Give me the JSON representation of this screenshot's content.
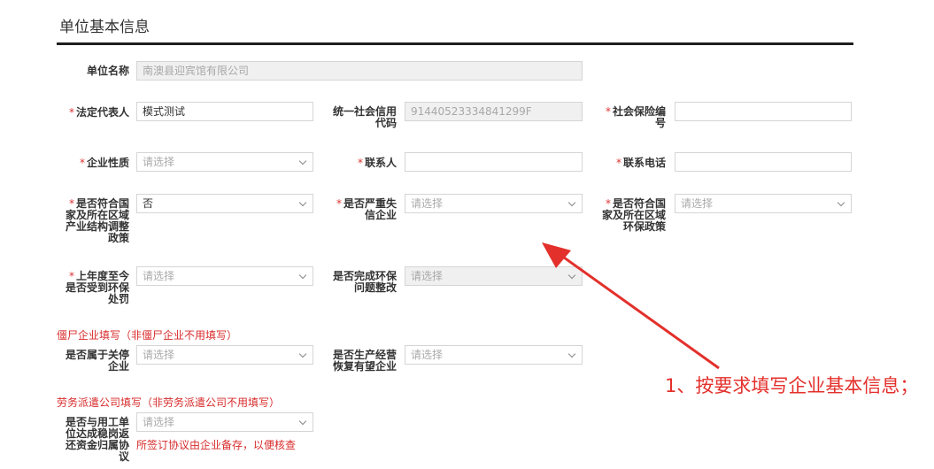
{
  "section": {
    "title": "单位基本信息"
  },
  "fields": {
    "unit_name": {
      "label": "单位名称",
      "value": "南澳县迎宾馆有限公司"
    },
    "legal_rep": {
      "label": "法定代表人",
      "value": "模式测试"
    },
    "credit_code": {
      "label": "统一社会信用代码",
      "value": "91440523334841299F"
    },
    "social_ins_no": {
      "label": "社会保险编号",
      "value": ""
    },
    "enterprise_type": {
      "label": "企业性质",
      "placeholder": "请选择"
    },
    "contact": {
      "label": "联系人",
      "value": ""
    },
    "phone": {
      "label": "联系电话",
      "value": ""
    },
    "industry_policy": {
      "label": "是否符合国家及所在区域产业结构调整政策",
      "value": "否"
    },
    "dishonest": {
      "label": "是否严重失信企业",
      "placeholder": "请选择"
    },
    "env_policy": {
      "label": "是否符合国家及所在区域环保政策",
      "placeholder": "请选择"
    },
    "env_penalty": {
      "label": "上年度至今是否受到环保处罚",
      "placeholder": "请选择"
    },
    "env_rectify": {
      "label": "是否完成环保问题整改",
      "placeholder": "请选择"
    },
    "shutdown": {
      "label": "是否属于关停企业",
      "placeholder": "请选择"
    },
    "resume": {
      "label": "是否生产经营恢复有望企业",
      "placeholder": "请选择"
    },
    "agreement": {
      "label": "是否与用工单位达成稳岗返还资金归属协议",
      "placeholder": "请选择"
    }
  },
  "notes": {
    "zombie": "僵尸企业填写（非僵尸企业不用填写）",
    "dispatch": "劳务派遣公司填写（非劳务派遣公司不用填写）",
    "agreement_hint": "所签订协议由企业备存，以便核查"
  },
  "annotation": {
    "text": "1、按要求填写企业基本信息；"
  },
  "colors": {
    "required": "#e03232",
    "note": "#d82b2b",
    "annotation": "#e3302b"
  }
}
